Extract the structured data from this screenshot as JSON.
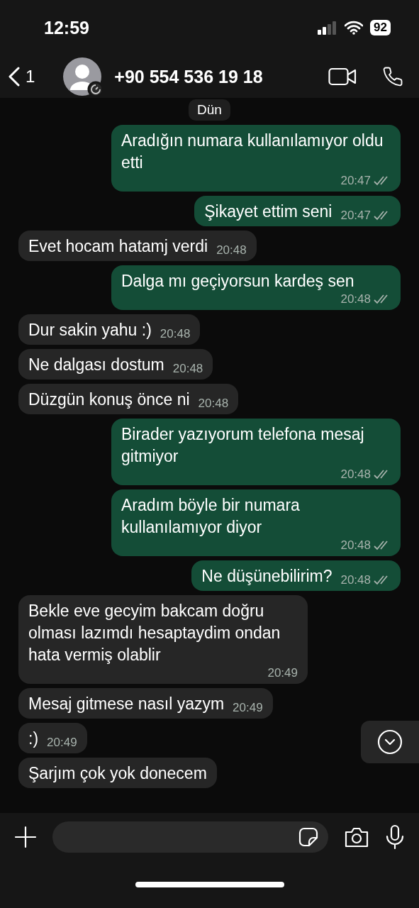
{
  "status_bar": {
    "time": "12:59",
    "battery": "92"
  },
  "header": {
    "back_count": "1",
    "contact": "+90 554 536 19 18"
  },
  "date_badge": "Dün",
  "messages": [
    {
      "kind": "outgoing",
      "text": "Aradığın numara kullanılamıyor oldu etti",
      "time": "20:47"
    },
    {
      "kind": "outgoing",
      "text": "Şikayet ettim seni",
      "time": "20:47"
    },
    {
      "kind": "incoming",
      "text": "Evet hocam hatamj verdi",
      "time": "20:48"
    },
    {
      "kind": "outgoing",
      "text": "Dalga mı geçiyorsun kardeş sen",
      "time": "20:48"
    },
    {
      "kind": "incoming",
      "text": "Dur sakin yahu :)",
      "time": "20:48"
    },
    {
      "kind": "incoming",
      "text": "Ne dalgası dostum",
      "time": "20:48"
    },
    {
      "kind": "incoming",
      "text": "Düzgün konuş önce ni",
      "time": "20:48"
    },
    {
      "kind": "outgoing",
      "text": "Birader yazıyorum telefona mesaj gitmiyor",
      "time": "20:48"
    },
    {
      "kind": "outgoing",
      "text": "Aradım böyle bir numara kullanılamıyor diyor",
      "time": "20:48"
    },
    {
      "kind": "outgoing",
      "text": "Ne düşünebilirim?",
      "time": "20:48"
    },
    {
      "kind": "incoming",
      "text": "Bekle eve gecyim bakcam doğru olması lazımdı hesaptaydim ondan hata vermiş olablir",
      "time": "20:49"
    },
    {
      "kind": "incoming",
      "text": "Mesaj gitmese nasıl yazym",
      "time": "20:49"
    },
    {
      "kind": "incoming",
      "text": ":)",
      "time": "20:49"
    },
    {
      "kind": "incoming",
      "text": "Şarjım çok yok donecem"
    }
  ]
}
